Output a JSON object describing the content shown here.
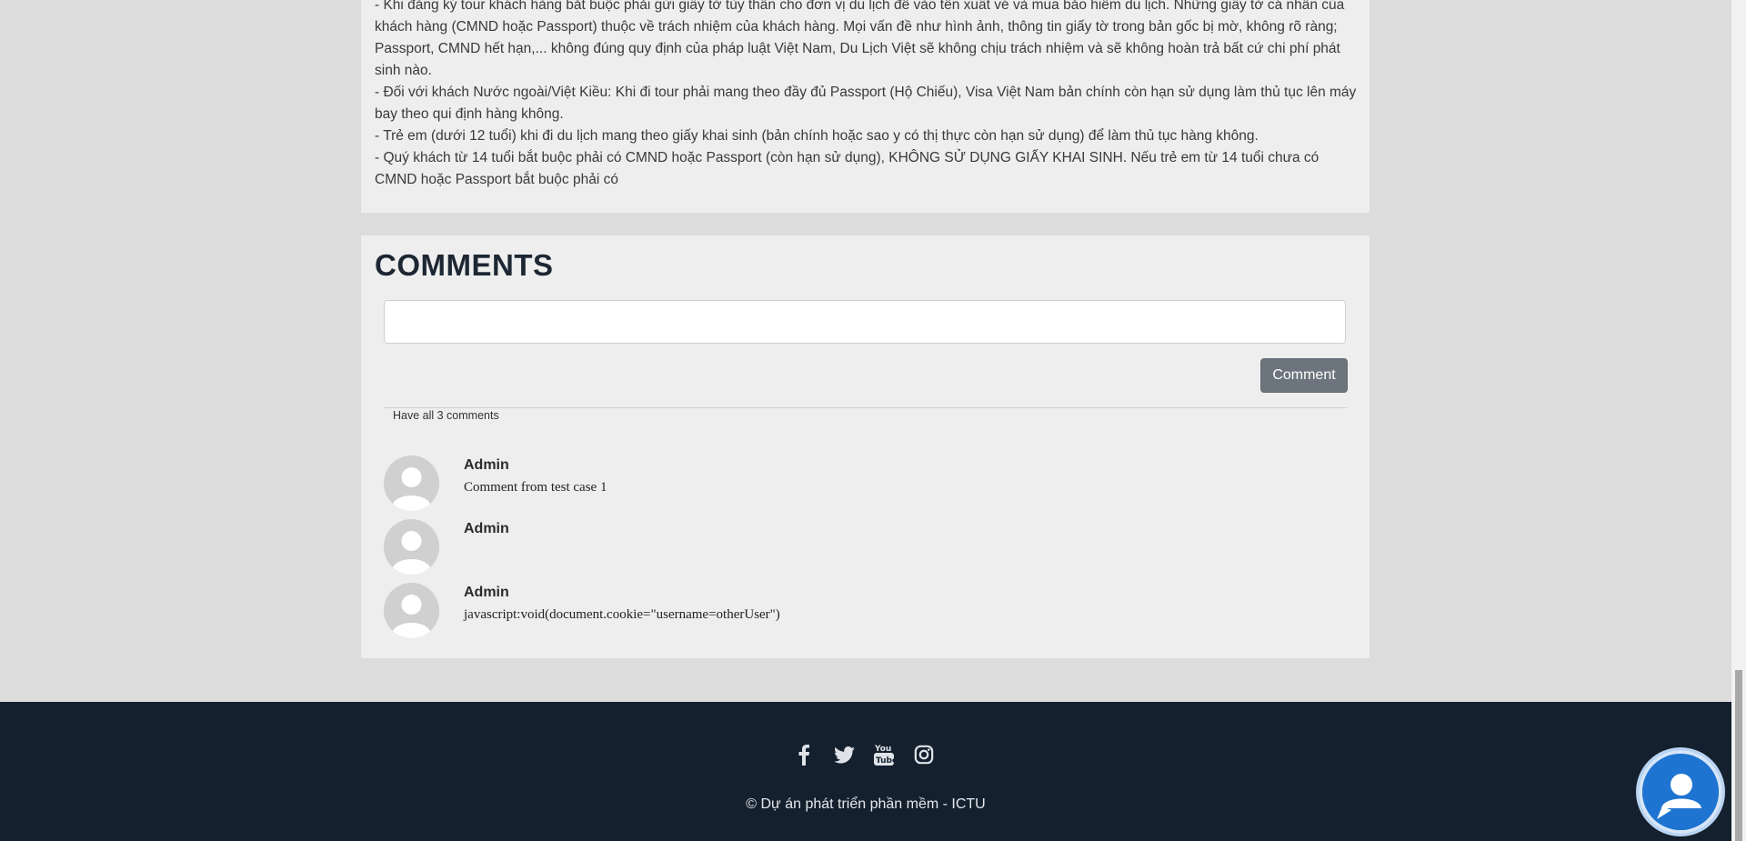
{
  "notes": {
    "lines": [
      "-    Khi đăng ký tour khách hàng bắt buộc phải gửi giấy tờ tùy thân cho đơn vị du lịch để vào tên xuất vé và mua bảo hiểm du lịch. Những giấy tờ cá nhân của khách hàng (CMND hoặc Passport) thuộc về trách nhiệm của khách hàng. Mọi vấn đề như hình ảnh, thông tin giấy tờ trong bản gốc bị mờ, không rõ ràng; Passport, CMND hết hạn,... không đúng quy định của pháp luật Việt Nam, Du Lịch Việt sẽ không chịu trách nhiệm và sẽ không hoàn trả bất cứ chi phí phát sinh nào.",
      "-    Đối với khách Nước ngoài/Việt Kiều: Khi đi tour phải mang theo đầy đủ Passport (Hộ Chiếu), Visa Việt Nam bản chính còn hạn sử dụng làm thủ tục lên máy bay theo qui định hàng không.",
      "-    Trẻ em (dưới 12 tuổi) khi đi du lịch mang theo giấy khai sinh (bản chính hoặc sao y có thị thực còn hạn sử dụng) để  làm thủ tục hàng không.",
      "-    Quý khách từ 14 tuổi bắt buộc phải có CMND hoặc Passport (còn hạn sử dụng), KHÔNG SỬ DỤNG GIẤY KHAI SINH. Nếu trẻ em từ 14 tuổi chưa có CMND hoặc Passport bắt buộc phải có"
    ]
  },
  "comments": {
    "title": "COMMENTS",
    "input_value": "",
    "button_label": "Comment",
    "count_text": "Have all 3 comments",
    "items": [
      {
        "author": "Admin",
        "text": "Comment from test case 1"
      },
      {
        "author": "Admin",
        "text": ""
      },
      {
        "author": "Admin",
        "text": "javascript:void(document.cookie=\"username=otherUser\")"
      }
    ]
  },
  "footer": {
    "social": [
      "facebook-icon",
      "twitter-icon",
      "youtube-icon",
      "instagram-icon"
    ],
    "copyright": "© Dự án phát triển phần mềm - ICTU",
    "bg_color": "#14202e"
  },
  "colors": {
    "page_bg": "#dcdcdc",
    "card_bg": "#eeeeee",
    "button_bg": "#6c757d",
    "chat_button": "#1f74d1"
  }
}
